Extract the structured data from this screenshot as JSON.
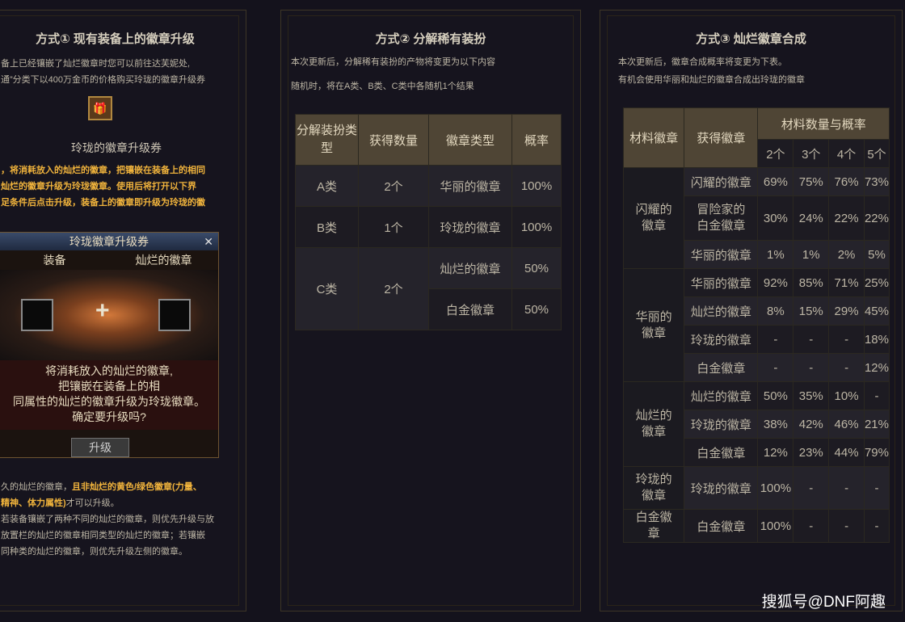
{
  "panel1": {
    "title": "方式① 现有装备上的徽章升级",
    "intro_line1": "备上已经镶嵌了灿烂徽章时您可以前往达芙妮处,",
    "intro_line2": "通”分类下以400万金币的价格购买玲珑的徽章升级券",
    "ticket_name": "玲珑的徽章升级券",
    "desc_line1": "，将消耗放入的灿烂的徽章，把镶嵌在装备上的相同",
    "desc_line2": "灿烂的徽章升级为玲珑徽章。使用后将打开以下界",
    "desc_line3": "足条件后点击升级，装备上的徽章即升级为玲珑的徽",
    "window": {
      "title": "玲珑徽章升级券",
      "close": "✕",
      "col_left": "装备",
      "col_right": "灿烂的徽章",
      "plus": "+",
      "text_line1": "将消耗放入的灿烂的徽章,",
      "text_line2": "把镶嵌在装备上的相",
      "text_line3": "同属性的灿烂的徽章升级为玲珑徽章。",
      "text_line4": "确定要升级吗?",
      "button": "升级"
    },
    "foot_line1a": "久的灿烂的徽章，",
    "foot_line1b": "且非灿烂的黄色/绿色徽章(力量、",
    "foot_line2a": "精神、体力属性)",
    "foot_line2b": "才可以升级。",
    "foot_line3": "若装备镶嵌了两种不同的灿烂的徽章，则优先升级与放",
    "foot_line4": "放置栏的灿烂的徽章相同类型的灿烂的徽章；若镶嵌",
    "foot_line5": "同种类的灿烂的徽章，则优先升级左侧的徽章。"
  },
  "panel2": {
    "title": "方式② 分解稀有装扮",
    "note1": "本次更新后，分解稀有装扮的产物将变更为以下内容",
    "note2": "随机时，将在A类、B类、C类中各随机1个结果",
    "headers": [
      "分解装扮类型",
      "获得数量",
      "徽章类型",
      "概率"
    ],
    "rows": [
      {
        "type": "A类",
        "qty": "2个",
        "badge": "华丽的徽章",
        "rate": "100%"
      },
      {
        "type": "B类",
        "qty": "1个",
        "badge": "玲珑的徽章",
        "rate": "100%"
      },
      {
        "type": "C类",
        "qty": "2个",
        "badge": "灿烂的徽章",
        "rate": "50%"
      },
      {
        "type": "",
        "qty": "",
        "badge": "白金徽章",
        "rate": "50%"
      }
    ]
  },
  "panel3": {
    "title": "方式③ 灿烂徽章合成",
    "note1": "本次更新后，徽章合成概率将变更为下表。",
    "note2": "有机会使用华丽和灿烂的徽章合成出玲珑的徽章",
    "h_material": "材料徽章",
    "h_result": "获得徽章",
    "h_prob": "材料数量与概率",
    "counts": [
      "2个",
      "3个",
      "4个",
      "5个"
    ],
    "groups": [
      {
        "material": "闪耀的徽章",
        "rows": [
          {
            "result": "闪耀的徽章",
            "p": [
              "69%",
              "75%",
              "76%",
              "73%"
            ]
          },
          {
            "result": "冒险家的白金徽章",
            "p": [
              "30%",
              "24%",
              "22%",
              "22%"
            ]
          },
          {
            "result": "华丽的徽章",
            "p": [
              "1%",
              "1%",
              "2%",
              "5%"
            ]
          }
        ]
      },
      {
        "material": "华丽的徽章",
        "rows": [
          {
            "result": "华丽的徽章",
            "p": [
              "92%",
              "85%",
              "71%",
              "25%"
            ]
          },
          {
            "result": "灿烂的徽章",
            "p": [
              "8%",
              "15%",
              "29%",
              "45%"
            ]
          },
          {
            "result": "玲珑的徽章",
            "p": [
              "-",
              "-",
              "-",
              "18%"
            ]
          },
          {
            "result": "白金徽章",
            "p": [
              "-",
              "-",
              "-",
              "12%"
            ]
          }
        ]
      },
      {
        "material": "灿烂的徽章",
        "rows": [
          {
            "result": "灿烂的徽章",
            "p": [
              "50%",
              "35%",
              "10%",
              "-"
            ]
          },
          {
            "result": "玲珑的徽章",
            "p": [
              "38%",
              "42%",
              "46%",
              "21%"
            ]
          },
          {
            "result": "白金徽章",
            "p": [
              "12%",
              "23%",
              "44%",
              "79%"
            ]
          }
        ]
      },
      {
        "material": "玲珑的徽章",
        "rows": [
          {
            "result": "玲珑的徽章",
            "p": [
              "100%",
              "-",
              "-",
              "-"
            ]
          }
        ]
      },
      {
        "material": "白金徽章",
        "rows": [
          {
            "result": "白金徽章",
            "p": [
              "100%",
              "-",
              "-",
              "-"
            ]
          }
        ]
      }
    ]
  },
  "watermark": "搜狐号@DNF阿趣"
}
